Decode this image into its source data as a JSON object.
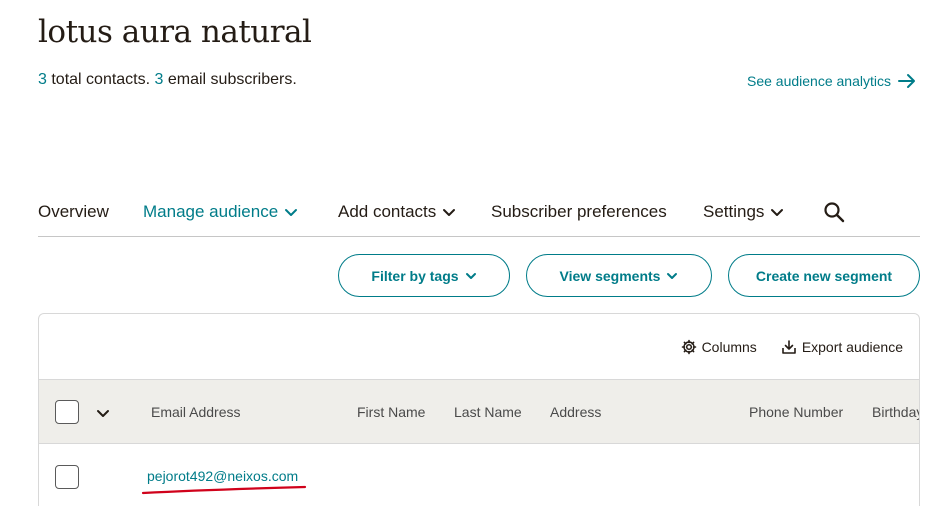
{
  "header": {
    "title": "lotus aura natural",
    "summary_total_count": "3",
    "summary_total_text": " total contacts. ",
    "summary_email_count": "3",
    "summary_email_text": " email subscribers.",
    "analytics_link": "See audience analytics"
  },
  "nav": {
    "overview": "Overview",
    "manage_audience": "Manage audience",
    "add_contacts": "Add contacts",
    "subscriber_preferences": "Subscriber preferences",
    "settings": "Settings"
  },
  "filters": {
    "filter_by_tags": "Filter by tags",
    "view_segments": "View segments",
    "create_segment": "Create new segment"
  },
  "toolbar": {
    "columns": "Columns",
    "export": "Export audience"
  },
  "table": {
    "columns": [
      "Email Address",
      "First Name",
      "Last Name",
      "Address",
      "Phone Number",
      "Birthday"
    ],
    "rows": [
      {
        "email": "pejorot492@neixos.com"
      }
    ]
  },
  "colors": {
    "accent": "#007c89",
    "text": "#241c15",
    "table_header_bg": "#efeeea",
    "annotation": "#d0021b"
  },
  "icons": [
    "arrow-right-icon",
    "chevron-down-icon",
    "search-icon",
    "gear-icon",
    "download-icon"
  ]
}
